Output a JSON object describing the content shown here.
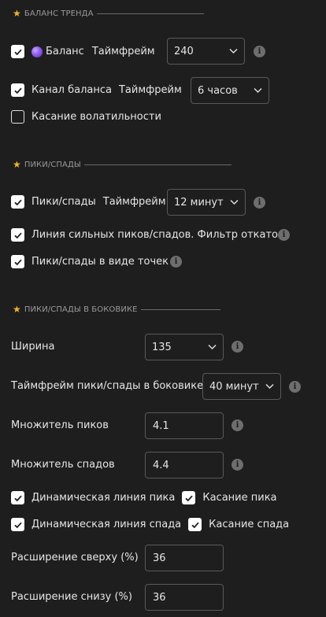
{
  "sections": {
    "trend_balance": "БАЛАНС ТРЕНДА",
    "peaks": "ПИКИ/СПАДЫ",
    "sideways": "ПИКИ/СПАДЫ В БОКОВИКЕ"
  },
  "balance": {
    "label": "Баланс",
    "tf_label": "Таймфрейм",
    "tf_value": "240",
    "checked": true
  },
  "balance_channel": {
    "label": "Канал баланса",
    "tf_label": "Таймфрейм",
    "tf_value": "6 часов",
    "checked": true
  },
  "volatility_touch": {
    "label": "Касание волатильности",
    "checked": false
  },
  "peaks_valleys": {
    "label": "Пики/спады",
    "tf_label": "Таймфрейм",
    "tf_value": "12 минут",
    "checked": true
  },
  "strong_line": {
    "label": "Линия сильных пиков/спадов. Фильтр откатов",
    "checked": true
  },
  "dots": {
    "label": "Пики/спады в виде точек",
    "checked": true
  },
  "width": {
    "label": "Ширина",
    "value": "135"
  },
  "sideways_tf": {
    "label": "Таймфрейм пики/спады в боковике",
    "value": "40 минут"
  },
  "peak_mult": {
    "label": "Множитель пиков",
    "value": "4.1"
  },
  "valley_mult": {
    "label": "Множитель спадов",
    "value": "4.4"
  },
  "dyn_peak": {
    "label": "Динамическая линия пика",
    "checked": true
  },
  "peak_touch": {
    "label": "Касание пика",
    "checked": true
  },
  "dyn_valley": {
    "label": "Динамическая линия спада",
    "checked": true
  },
  "valley_touch": {
    "label": "Касание спада",
    "checked": true
  },
  "ext_top": {
    "label": "Расширение сверху (%)",
    "value": "36"
  },
  "ext_bottom": {
    "label": "Расширение снизу (%)",
    "value": "36"
  },
  "info_glyph": "i"
}
